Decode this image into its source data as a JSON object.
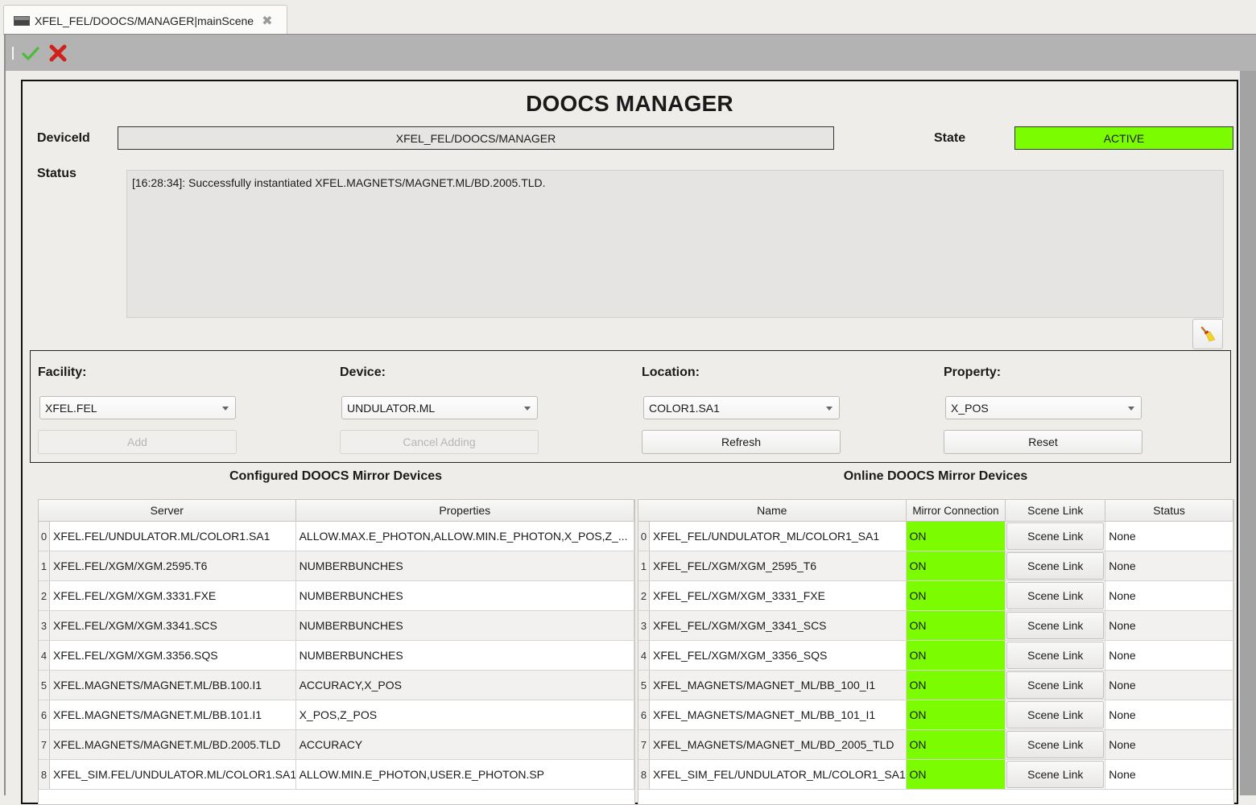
{
  "tab": {
    "title": "XFEL_FEL/DOOCS/MANAGER|mainScene",
    "icon": "scene-icon",
    "close_icon": "close-icon"
  },
  "toolbar": {
    "apply_icon": "check-icon",
    "cancel_icon": "x-icon"
  },
  "header": {
    "title": "DOOCS MANAGER",
    "device_id_label": "DeviceId",
    "device_id_value": "XFEL_FEL/DOOCS/MANAGER",
    "state_label": "State",
    "state_value": "ACTIVE",
    "state_color": "#7cfc00",
    "status_label": "Status",
    "status_text": "[16:28:34]: Successfully instantiated XFEL.MAGNETS/MAGNET.ML/BD.2005.TLD.",
    "clear_icon": "broom-icon"
  },
  "selection": {
    "facility": {
      "label": "Facility:",
      "value": "XFEL.FEL",
      "button": "Add",
      "button_enabled": false
    },
    "device": {
      "label": "Device:",
      "value": "UNDULATOR.ML",
      "button": "Cancel Adding",
      "button_enabled": false
    },
    "location": {
      "label": "Location:",
      "value": "COLOR1.SA1",
      "button": "Refresh",
      "button_enabled": true
    },
    "property": {
      "label": "Property:",
      "value": "X_POS",
      "button": "Reset",
      "button_enabled": true
    }
  },
  "configured": {
    "title": "Configured DOOCS Mirror Devices",
    "columns": [
      "Server",
      "Properties"
    ],
    "rows": [
      {
        "index": "0",
        "server": "XFEL.FEL/UNDULATOR.ML/COLOR1.SA1",
        "properties": "ALLOW.MAX.E_PHOTON,ALLOW.MIN.E_PHOTON,X_POS,Z_..."
      },
      {
        "index": "1",
        "server": "XFEL.FEL/XGM/XGM.2595.T6",
        "properties": "NUMBERBUNCHES"
      },
      {
        "index": "2",
        "server": "XFEL.FEL/XGM/XGM.3331.FXE",
        "properties": "NUMBERBUNCHES"
      },
      {
        "index": "3",
        "server": "XFEL.FEL/XGM/XGM.3341.SCS",
        "properties": "NUMBERBUNCHES"
      },
      {
        "index": "4",
        "server": "XFEL.FEL/XGM/XGM.3356.SQS",
        "properties": "NUMBERBUNCHES"
      },
      {
        "index": "5",
        "server": "XFEL.MAGNETS/MAGNET.ML/BB.100.I1",
        "properties": "ACCURACY,X_POS"
      },
      {
        "index": "6",
        "server": "XFEL.MAGNETS/MAGNET.ML/BB.101.I1",
        "properties": "X_POS,Z_POS"
      },
      {
        "index": "7",
        "server": "XFEL.MAGNETS/MAGNET.ML/BD.2005.TLD",
        "properties": "ACCURACY"
      },
      {
        "index": "8",
        "server": "XFEL_SIM.FEL/UNDULATOR.ML/COLOR1.SA1",
        "properties": "ALLOW.MIN.E_PHOTON,USER.E_PHOTON.SP"
      }
    ]
  },
  "online": {
    "title": "Online DOOCS Mirror Devices",
    "columns": [
      "Name",
      "Mirror Connection",
      "Scene Link",
      "Status"
    ],
    "on_color": "#7cfc00",
    "rows": [
      {
        "index": "0",
        "name": "XFEL_FEL/UNDULATOR_ML/COLOR1_SA1",
        "connection": "ON",
        "scene_link": "Scene Link",
        "status": "None"
      },
      {
        "index": "1",
        "name": "XFEL_FEL/XGM/XGM_2595_T6",
        "connection": "ON",
        "scene_link": "Scene Link",
        "status": "None"
      },
      {
        "index": "2",
        "name": "XFEL_FEL/XGM/XGM_3331_FXE",
        "connection": "ON",
        "scene_link": "Scene Link",
        "status": "None"
      },
      {
        "index": "3",
        "name": "XFEL_FEL/XGM/XGM_3341_SCS",
        "connection": "ON",
        "scene_link": "Scene Link",
        "status": "None"
      },
      {
        "index": "4",
        "name": "XFEL_FEL/XGM/XGM_3356_SQS",
        "connection": "ON",
        "scene_link": "Scene Link",
        "status": "None"
      },
      {
        "index": "5",
        "name": "XFEL_MAGNETS/MAGNET_ML/BB_100_I1",
        "connection": "ON",
        "scene_link": "Scene Link",
        "status": "None"
      },
      {
        "index": "6",
        "name": "XFEL_MAGNETS/MAGNET_ML/BB_101_I1",
        "connection": "ON",
        "scene_link": "Scene Link",
        "status": "None"
      },
      {
        "index": "7",
        "name": "XFEL_MAGNETS/MAGNET_ML/BD_2005_TLD",
        "connection": "ON",
        "scene_link": "Scene Link",
        "status": "None"
      },
      {
        "index": "8",
        "name": "XFEL_SIM_FEL/UNDULATOR_ML/COLOR1_SA1",
        "connection": "ON",
        "scene_link": "Scene Link",
        "status": "None"
      }
    ]
  }
}
